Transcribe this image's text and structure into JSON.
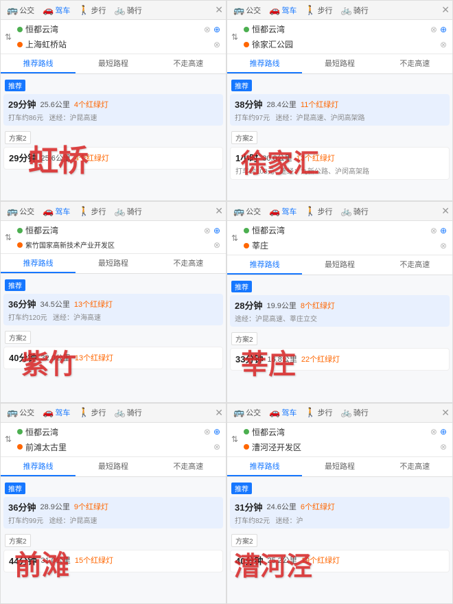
{
  "panels": [
    {
      "id": "panel-1",
      "transport_modes": [
        "公交",
        "驾车",
        "步行",
        "骑行"
      ],
      "active_mode": "驾车",
      "origin": "恒都云湾",
      "destination": "上海虹桥站",
      "tabs": [
        "推荐路线",
        "最短路程",
        "不走高速"
      ],
      "active_tab": "推荐路线",
      "recommend_badge": "推荐",
      "recommend": {
        "time": "29分钟",
        "dist": "25.6公里",
        "lights": "4个红绿灯",
        "cost": "打车约86元",
        "via": "迷经：沪昆高速"
      },
      "scheme2_badge": "方案2",
      "scheme2": {
        "time": "29分钟",
        "dist": "25.6公里",
        "lights": "4个红绿灯"
      },
      "watermark": "虹桥"
    },
    {
      "id": "panel-2",
      "transport_modes": [
        "公交",
        "驾车",
        "步行",
        "骑行"
      ],
      "active_mode": "驾车",
      "origin": "恒都云湾",
      "destination": "徐家汇公园",
      "tabs": [
        "推荐路线",
        "最短路程",
        "不走高速"
      ],
      "active_tab": "推荐路线",
      "recommend_badge": "推荐",
      "recommend": {
        "time": "38分钟",
        "dist": "28.4公里",
        "lights": "11个红绿灯",
        "cost": "打车约97元",
        "via": "迷经：沪昆高速、沪闵高架路"
      },
      "scheme2_badge": "方案2",
      "scheme2": {
        "time": "1小时",
        "dist": "30.0公里",
        "lights": "13个红绿灯",
        "cost": "打车约103元",
        "via": "途经：九新公路、沪闵高架路"
      },
      "watermark": "徐家汇"
    },
    {
      "id": "panel-3",
      "transport_modes": [
        "公交",
        "驾车",
        "步行",
        "骑行"
      ],
      "active_mode": "驾车",
      "origin": "恒都云湾",
      "destination": "紫竹国家高新技术产业开发区",
      "tabs": [
        "推荐路线",
        "最短路程",
        "不走高速"
      ],
      "active_tab": "推荐路线",
      "recommend_badge": "推荐",
      "recommend": {
        "time": "36分钟",
        "dist": "34.5公里",
        "lights": "13个红绿灯",
        "cost": "打车约120元",
        "via": "迷经：沪海高速"
      },
      "scheme2_badge": "方案2",
      "scheme2": {
        "time": "40分钟",
        "dist": "32.0公里",
        "lights": "13个红绿灯"
      },
      "watermark": "紫竹"
    },
    {
      "id": "panel-4",
      "transport_modes": [
        "公交",
        "驾车",
        "步行",
        "骑行"
      ],
      "active_mode": "驾车",
      "origin": "恒都云湾",
      "destination": "莘庄",
      "tabs": [
        "推荐路线",
        "最短路程",
        "不走高速"
      ],
      "active_tab": "推荐路线",
      "recommend_badge": "推荐",
      "recommend": {
        "time": "28分钟",
        "dist": "19.9公里",
        "lights": "8个红绿灯",
        "via": "途经：沪昆高速、莘庄立交"
      },
      "scheme2_badge": "方案2",
      "scheme2": {
        "time": "33分钟",
        "dist": "16.8公里",
        "lights": "22个红绿灯"
      },
      "watermark": "莘庄"
    },
    {
      "id": "panel-5",
      "transport_modes": [
        "公交",
        "驾车",
        "步行",
        "骑行"
      ],
      "active_mode": "驾车",
      "origin": "恒都云湾",
      "destination": "前滩太古里",
      "tabs": [
        "推荐路线",
        "最短路程",
        "不走高速"
      ],
      "active_tab": "推荐路线",
      "recommend_badge": "推荐",
      "recommend": {
        "time": "36分钟",
        "dist": "28.9公里",
        "lights": "9个红绿灯",
        "cost": "打车约99元",
        "via": "途经：沪昆高速"
      },
      "scheme2_badge": "方案2",
      "scheme2": {
        "time": "44分钟",
        "dist": "31.0公里",
        "lights": "15个红绿灯"
      },
      "watermark": "前滩"
    },
    {
      "id": "panel-6",
      "transport_modes": [
        "公交",
        "驾车",
        "步行",
        "骑行"
      ],
      "active_mode": "驾车",
      "origin": "恒都云湾",
      "destination": "漕河泾开发区",
      "tabs": [
        "推荐路线",
        "最短路程",
        "不走高速"
      ],
      "active_tab": "推荐路线",
      "recommend_badge": "推荐",
      "recommend": {
        "time": "31分钟",
        "dist": "24.6公里",
        "lights": "6个红绿灯",
        "cost": "打车约82元",
        "via": "迷经：沪"
      },
      "scheme2_badge": "方案2",
      "scheme2": {
        "time": "40分钟",
        "dist": "25.2公里",
        "lights": "19个红绿灯"
      },
      "watermark": "漕河泾"
    }
  ],
  "icons": {
    "bus": "🚌",
    "car": "🚗",
    "walk": "🚶",
    "bike": "🚲",
    "close": "✕",
    "swap": "⇅",
    "clear": "⊗",
    "add": "⊕"
  }
}
